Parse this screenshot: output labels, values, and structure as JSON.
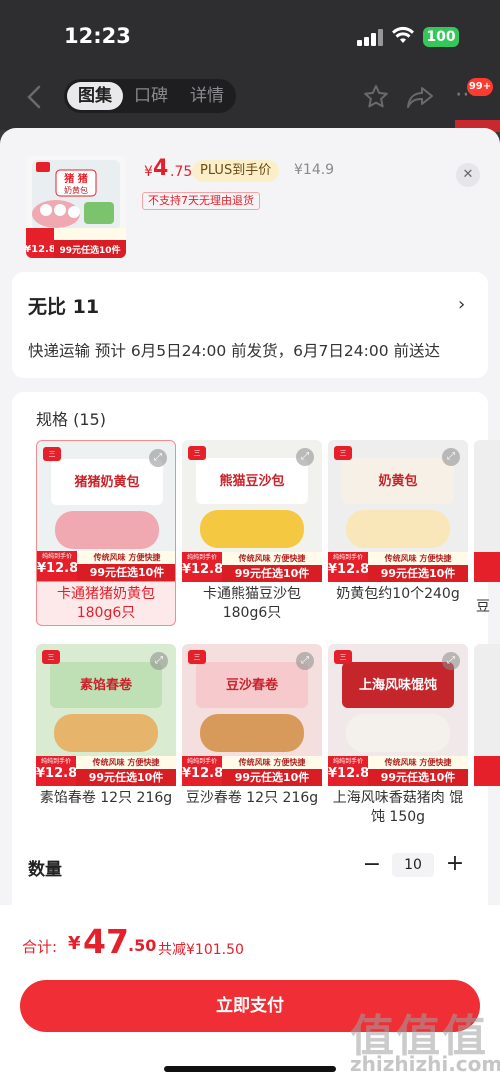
{
  "status_bar": {
    "time": "12:23",
    "battery": "100"
  },
  "top_nav": {
    "tabs": [
      {
        "label": "图集"
      },
      {
        "label": "口碑"
      },
      {
        "label": "详情"
      }
    ],
    "notification_badge": "99+"
  },
  "product": {
    "price_currency": "¥",
    "price_int": "4",
    "price_dec": ".75",
    "plus_label": "PLUS到手价",
    "original_price": "¥14.9",
    "no_return": "不支持7天无理由退货"
  },
  "address": {
    "name": "无比  11",
    "shipping": "快递运输 预计 6月5日24:00 前发货，6月7日24:00 前送达"
  },
  "specs": {
    "title": "规格 (15)",
    "banner": {
      "tag_top": "传统风味  方便快捷",
      "tag_bottom": "99元任选10件",
      "price_label": "纯纯到手价",
      "price": "¥12.8"
    },
    "items": [
      {
        "label": "卡通猪猪奶黄包 180g6只",
        "img_text": "猪猪奶黄包",
        "selected": true
      },
      {
        "label": "卡通熊猫豆沙包 180g6只",
        "img_text": "熊猫豆沙包",
        "selected": false
      },
      {
        "label": "奶黄包约10个240g",
        "img_text": "奶黄包",
        "selected": false
      },
      {
        "label": "素馅春卷 12只 216g",
        "img_text": "素馅春卷",
        "selected": false
      },
      {
        "label": "豆沙春卷 12只 216g",
        "img_text": "豆沙春卷",
        "selected": false
      },
      {
        "label": "上海风味香菇猪肉 馄饨 150g",
        "img_text": "上海风味馄饨",
        "selected": false
      }
    ],
    "partial_label": "豆"
  },
  "quantity": {
    "label": "数量",
    "value": "10"
  },
  "total": {
    "label": "合计:",
    "currency": "¥",
    "int": "47",
    "dec": ".50",
    "discount": "共减¥101.50"
  },
  "pay_button": "立即支付",
  "watermark": {
    "text": "值值值",
    "url": "zhizhizhi.com"
  },
  "colors": {
    "accent": "#e5202a",
    "pay_button": "#ef2f35",
    "plus_badge": "#fbefc9"
  }
}
